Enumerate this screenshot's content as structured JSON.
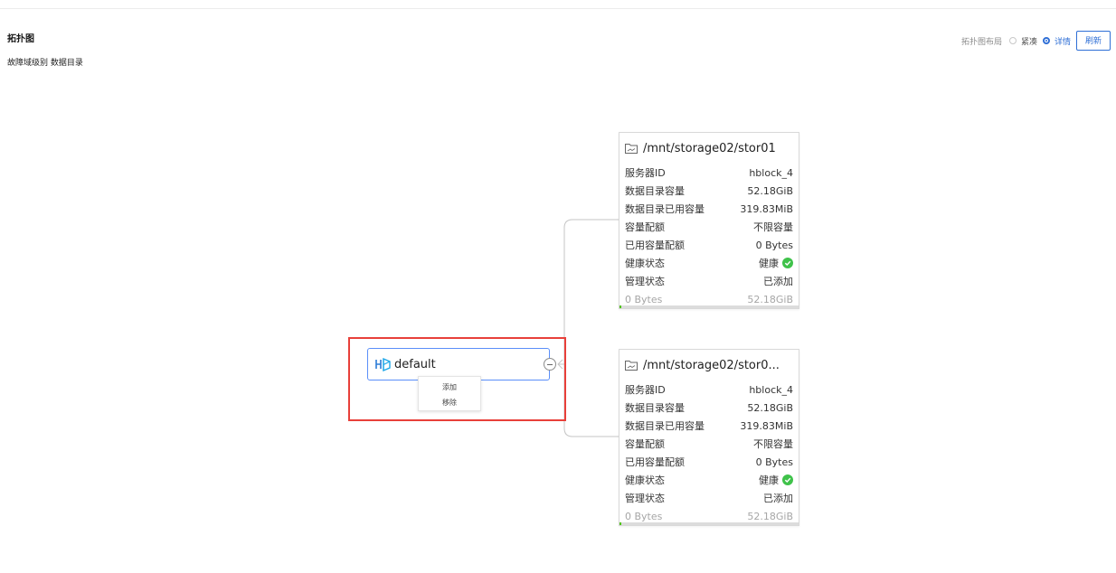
{
  "header": {
    "title": "拓扑图",
    "subtitle": "故障域级别 数据目录"
  },
  "layout_control": {
    "label": "拓扑图布局",
    "options": [
      {
        "label": "紧凑",
        "checked": false
      },
      {
        "label": "详情",
        "checked": true
      }
    ],
    "refresh_label": "刷新"
  },
  "root_node": {
    "name": "default",
    "icon": "hyperblock-logo-icon"
  },
  "context_menu": {
    "items": [
      "添加",
      "移除"
    ]
  },
  "cards": [
    {
      "path": "/mnt/storage02/stor01",
      "fields": [
        {
          "k": "服务器ID",
          "v": "hblock_4"
        },
        {
          "k": "数据目录容量",
          "v": "52.18GiB"
        },
        {
          "k": "数据目录已用容量",
          "v": "319.83MiB"
        },
        {
          "k": "容量配额",
          "v": "不限容量"
        },
        {
          "k": "已用容量配额",
          "v": "0 Bytes"
        },
        {
          "k": "健康状态",
          "v": "健康"
        },
        {
          "k": "管理状态",
          "v": "已添加"
        }
      ],
      "usage_left": "0 Bytes",
      "usage_right": "52.18GiB",
      "usage_fraction": 0.006
    },
    {
      "path": "/mnt/storage02/stor0...",
      "fields": [
        {
          "k": "服务器ID",
          "v": "hblock_4"
        },
        {
          "k": "数据目录容量",
          "v": "52.18GiB"
        },
        {
          "k": "数据目录已用容量",
          "v": "319.83MiB"
        },
        {
          "k": "容量配额",
          "v": "不限容量"
        },
        {
          "k": "已用容量配额",
          "v": "0 Bytes"
        },
        {
          "k": "健康状态",
          "v": "健康"
        },
        {
          "k": "管理状态",
          "v": "已添加"
        }
      ],
      "usage_left": "0 Bytes",
      "usage_right": "52.18GiB",
      "usage_fraction": 0.006
    }
  ],
  "colors": {
    "accent": "#2f6fd6",
    "node_border": "#5b8ff9",
    "healthy": "#3fc24a",
    "highlight": "#e8403a"
  }
}
